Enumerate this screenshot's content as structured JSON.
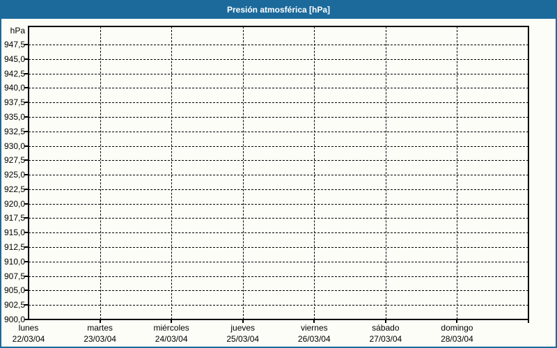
{
  "window": {
    "title": "Presión atmosférica [hPa]"
  },
  "chart_data": {
    "type": "line",
    "title": "Presión atmosférica [hPa]",
    "y_axis": {
      "unit_label": "hPa",
      "min": 900,
      "max": 950,
      "step": 2.5,
      "tick_labels": [
        "947,5",
        "945,0",
        "942,5",
        "940,0",
        "937,5",
        "935,0",
        "932,5",
        "930,0",
        "927,5",
        "925,0",
        "922,5",
        "920,0",
        "917,5",
        "915,0",
        "912,5",
        "910,0",
        "907,5",
        "905,0",
        "902,5",
        "900,0"
      ],
      "tick_values": [
        947.5,
        945.0,
        942.5,
        940.0,
        937.5,
        935.0,
        932.5,
        930.0,
        927.5,
        925.0,
        922.5,
        920.0,
        917.5,
        915.0,
        912.5,
        910.0,
        907.5,
        905.0,
        902.5,
        900.0
      ]
    },
    "x_axis": {
      "categories": [
        {
          "day": "lunes",
          "date": "22/03/04"
        },
        {
          "day": "martes",
          "date": "23/03/04"
        },
        {
          "day": "miércoles",
          "date": "24/03/04"
        },
        {
          "day": "jueves",
          "date": "25/03/04"
        },
        {
          "day": "viernes",
          "date": "26/03/04"
        },
        {
          "day": "sábado",
          "date": "27/03/04"
        },
        {
          "day": "domingo",
          "date": "28/03/04"
        }
      ]
    },
    "series": [],
    "grid": "dashed",
    "legend": "none"
  },
  "colors": {
    "titlebar_bg": "#1C6A9C",
    "titlebar_text": "#FFFFFF",
    "frame_border": "#1C6A9C",
    "page_bg": "#FCFDF7",
    "axis_ink": "#000000"
  }
}
